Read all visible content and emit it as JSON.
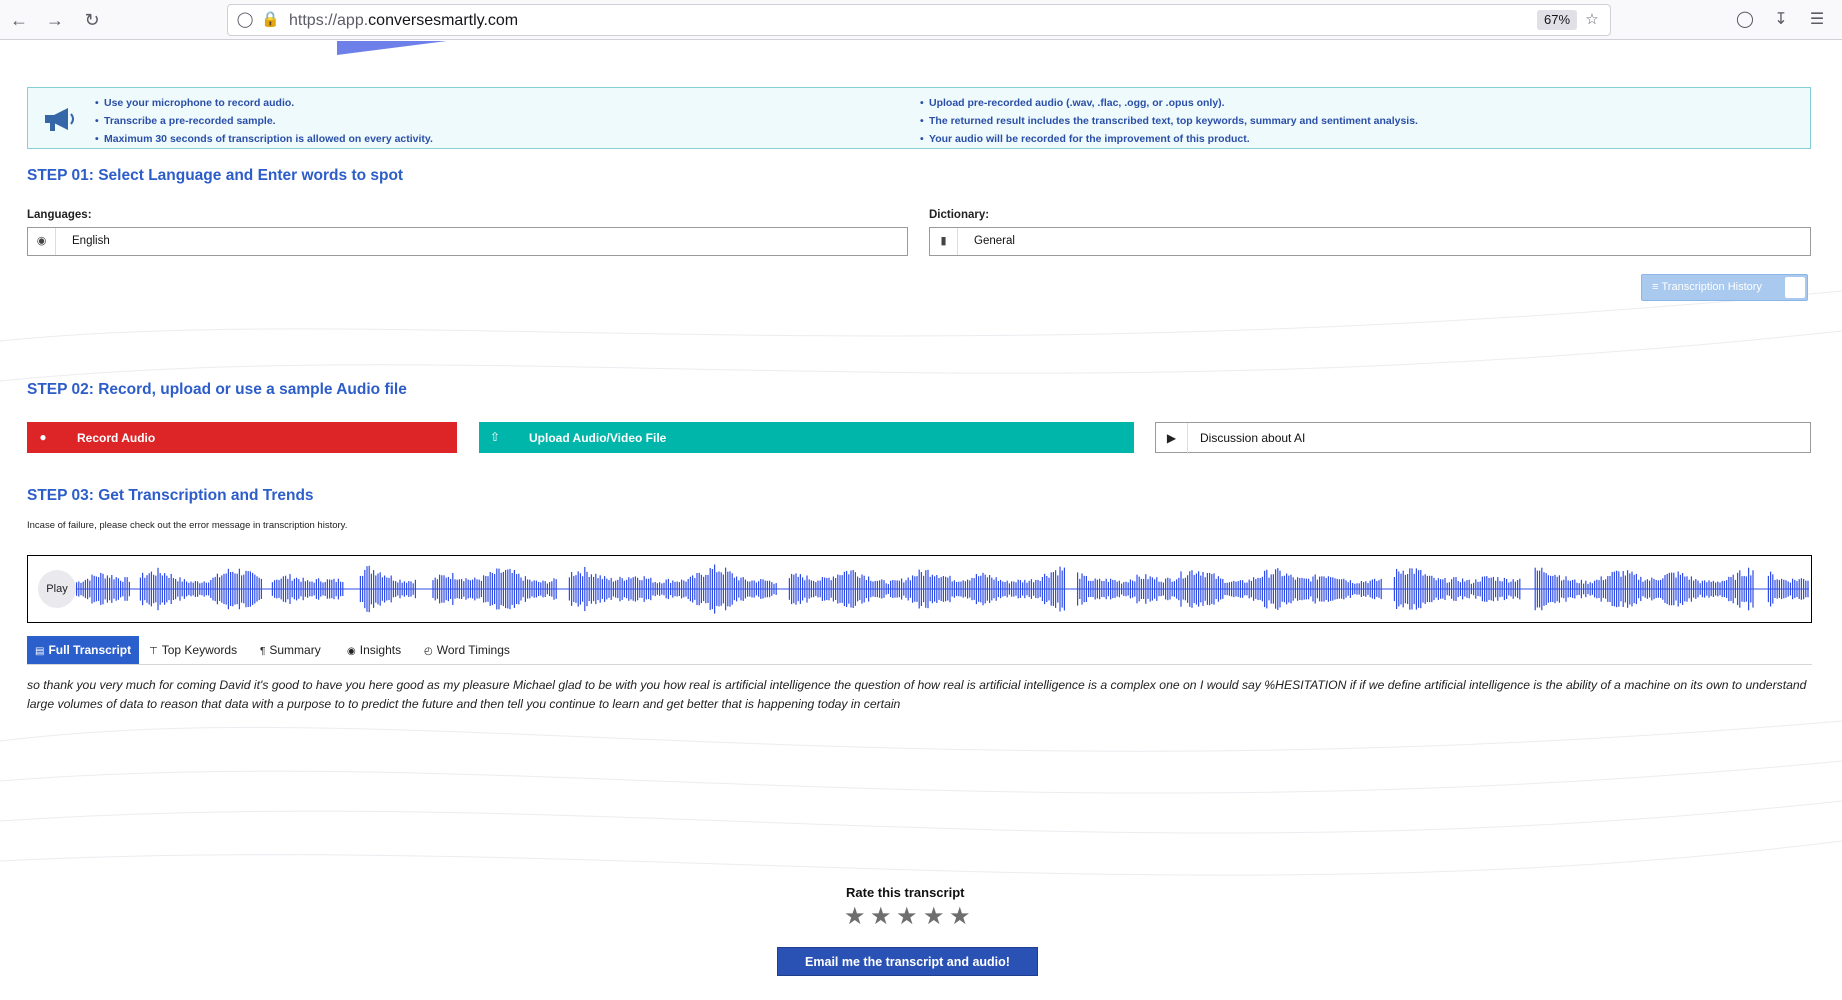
{
  "browser": {
    "url_prefix": "https://app.",
    "url_domain": "conversesmartly.com",
    "zoom": "67%"
  },
  "info": {
    "left_items": [
      "Use your microphone to record audio.",
      "Transcribe a pre-recorded sample.",
      "Maximum 30 seconds of transcription is allowed on every activity."
    ],
    "right_items": [
      "Upload pre-recorded audio (.wav, .flac, .ogg, or .opus only).",
      "The returned result includes the transcribed text, top keywords, summary and sentiment analysis.",
      "Your audio will be recorded for the improvement of this product."
    ]
  },
  "step1": {
    "title": "STEP 01: Select Language and Enter words to spot",
    "languages_label": "Languages:",
    "language_value": "English",
    "dictionary_label": "Dictionary:",
    "dictionary_value": "General",
    "history_button": "Transcription History"
  },
  "step2": {
    "title": "STEP 02: Record, upload or use a sample Audio file",
    "record_label": "Record Audio",
    "upload_label": "Upload Audio/Video File",
    "sample_label": "Discussion about AI"
  },
  "step3": {
    "title": "STEP 03: Get Transcription and Trends",
    "helper": "Incase of failure, please check out the error message in transcription history.",
    "play_label": "Play"
  },
  "tabs": [
    {
      "label": "Full Transcript",
      "icon": "document-icon"
    },
    {
      "label": "Top Keywords",
      "icon": "heading-icon"
    },
    {
      "label": "Summary",
      "icon": "paragraph-icon"
    },
    {
      "label": "Insights",
      "icon": "target-icon"
    },
    {
      "label": "Word Timings",
      "icon": "clock-icon"
    }
  ],
  "transcript": "so thank you very much for coming David it's good to have you here good as my pleasure Michael glad to be with you how real is artificial intelligence the question of how real is artificial intelligence is a complex one on I would say %HESITATION if if we define artificial intelligence is the ability of a machine on its own to understand large volumes of data to reason that data with a purpose to to predict the future and then tell you continue to learn and get better that is happening today in certain",
  "rating": {
    "title": "Rate this transcript",
    "stars": 5,
    "email_button": "Email me the transcript and audio!"
  },
  "colors": {
    "accent_blue": "#2c5dc9",
    "record_red": "#dd2427",
    "upload_teal": "#00b5aa",
    "waveform": "#2f4de6"
  }
}
